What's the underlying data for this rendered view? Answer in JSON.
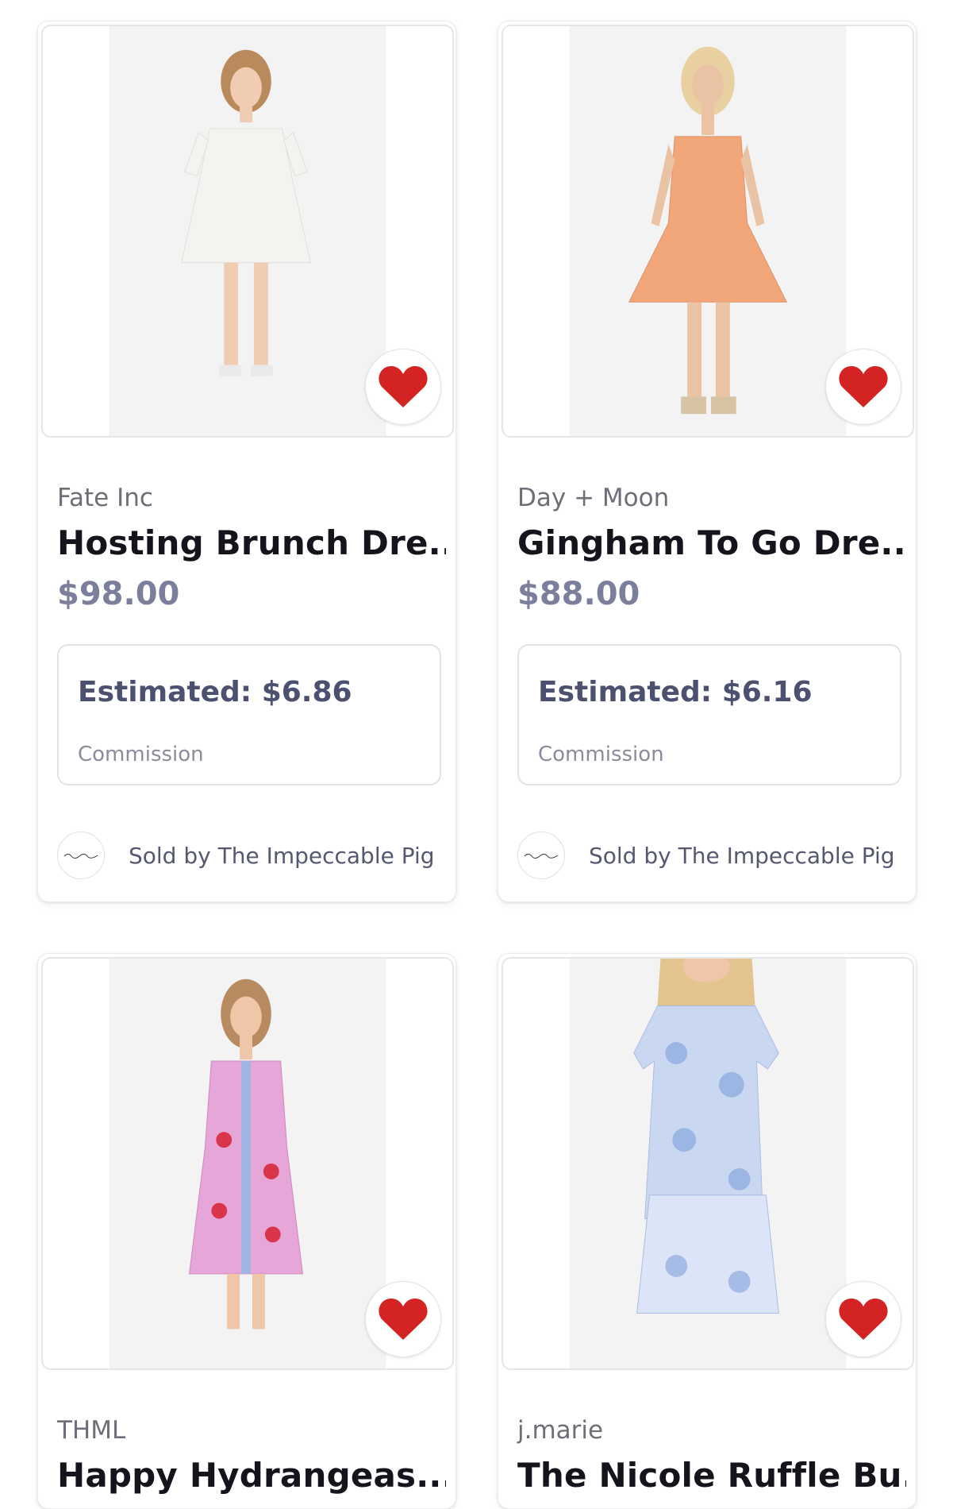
{
  "products": [
    {
      "brand": "Fate Inc",
      "title": "Hosting Brunch Dre...",
      "price": "$98.00",
      "estimated": "Estimated: $6.86",
      "commission_label": "Commission",
      "sold_by": "Sold by The Impeccable Pig",
      "dress_color": "#f4f3ef",
      "favorited": true
    },
    {
      "brand": "Day + Moon",
      "title": "Gingham To Go Dre...",
      "price": "$88.00",
      "estimated": "Estimated: $6.16",
      "commission_label": "Commission",
      "sold_by": "Sold by The Impeccable Pig",
      "dress_color": "#f2a77a",
      "favorited": true
    },
    {
      "brand": "THML",
      "title": "Happy Hydrangeas...",
      "dress_color": "#e7a6d8",
      "favorited": true
    },
    {
      "brand": "j.marie",
      "title": "The Nicole Ruffle Bu...",
      "dress_color": "#c9d7f0",
      "favorited": true
    }
  ],
  "colors": {
    "heart": "#d42323",
    "price": "#7c7f9c",
    "estimated": "#4d5170"
  }
}
